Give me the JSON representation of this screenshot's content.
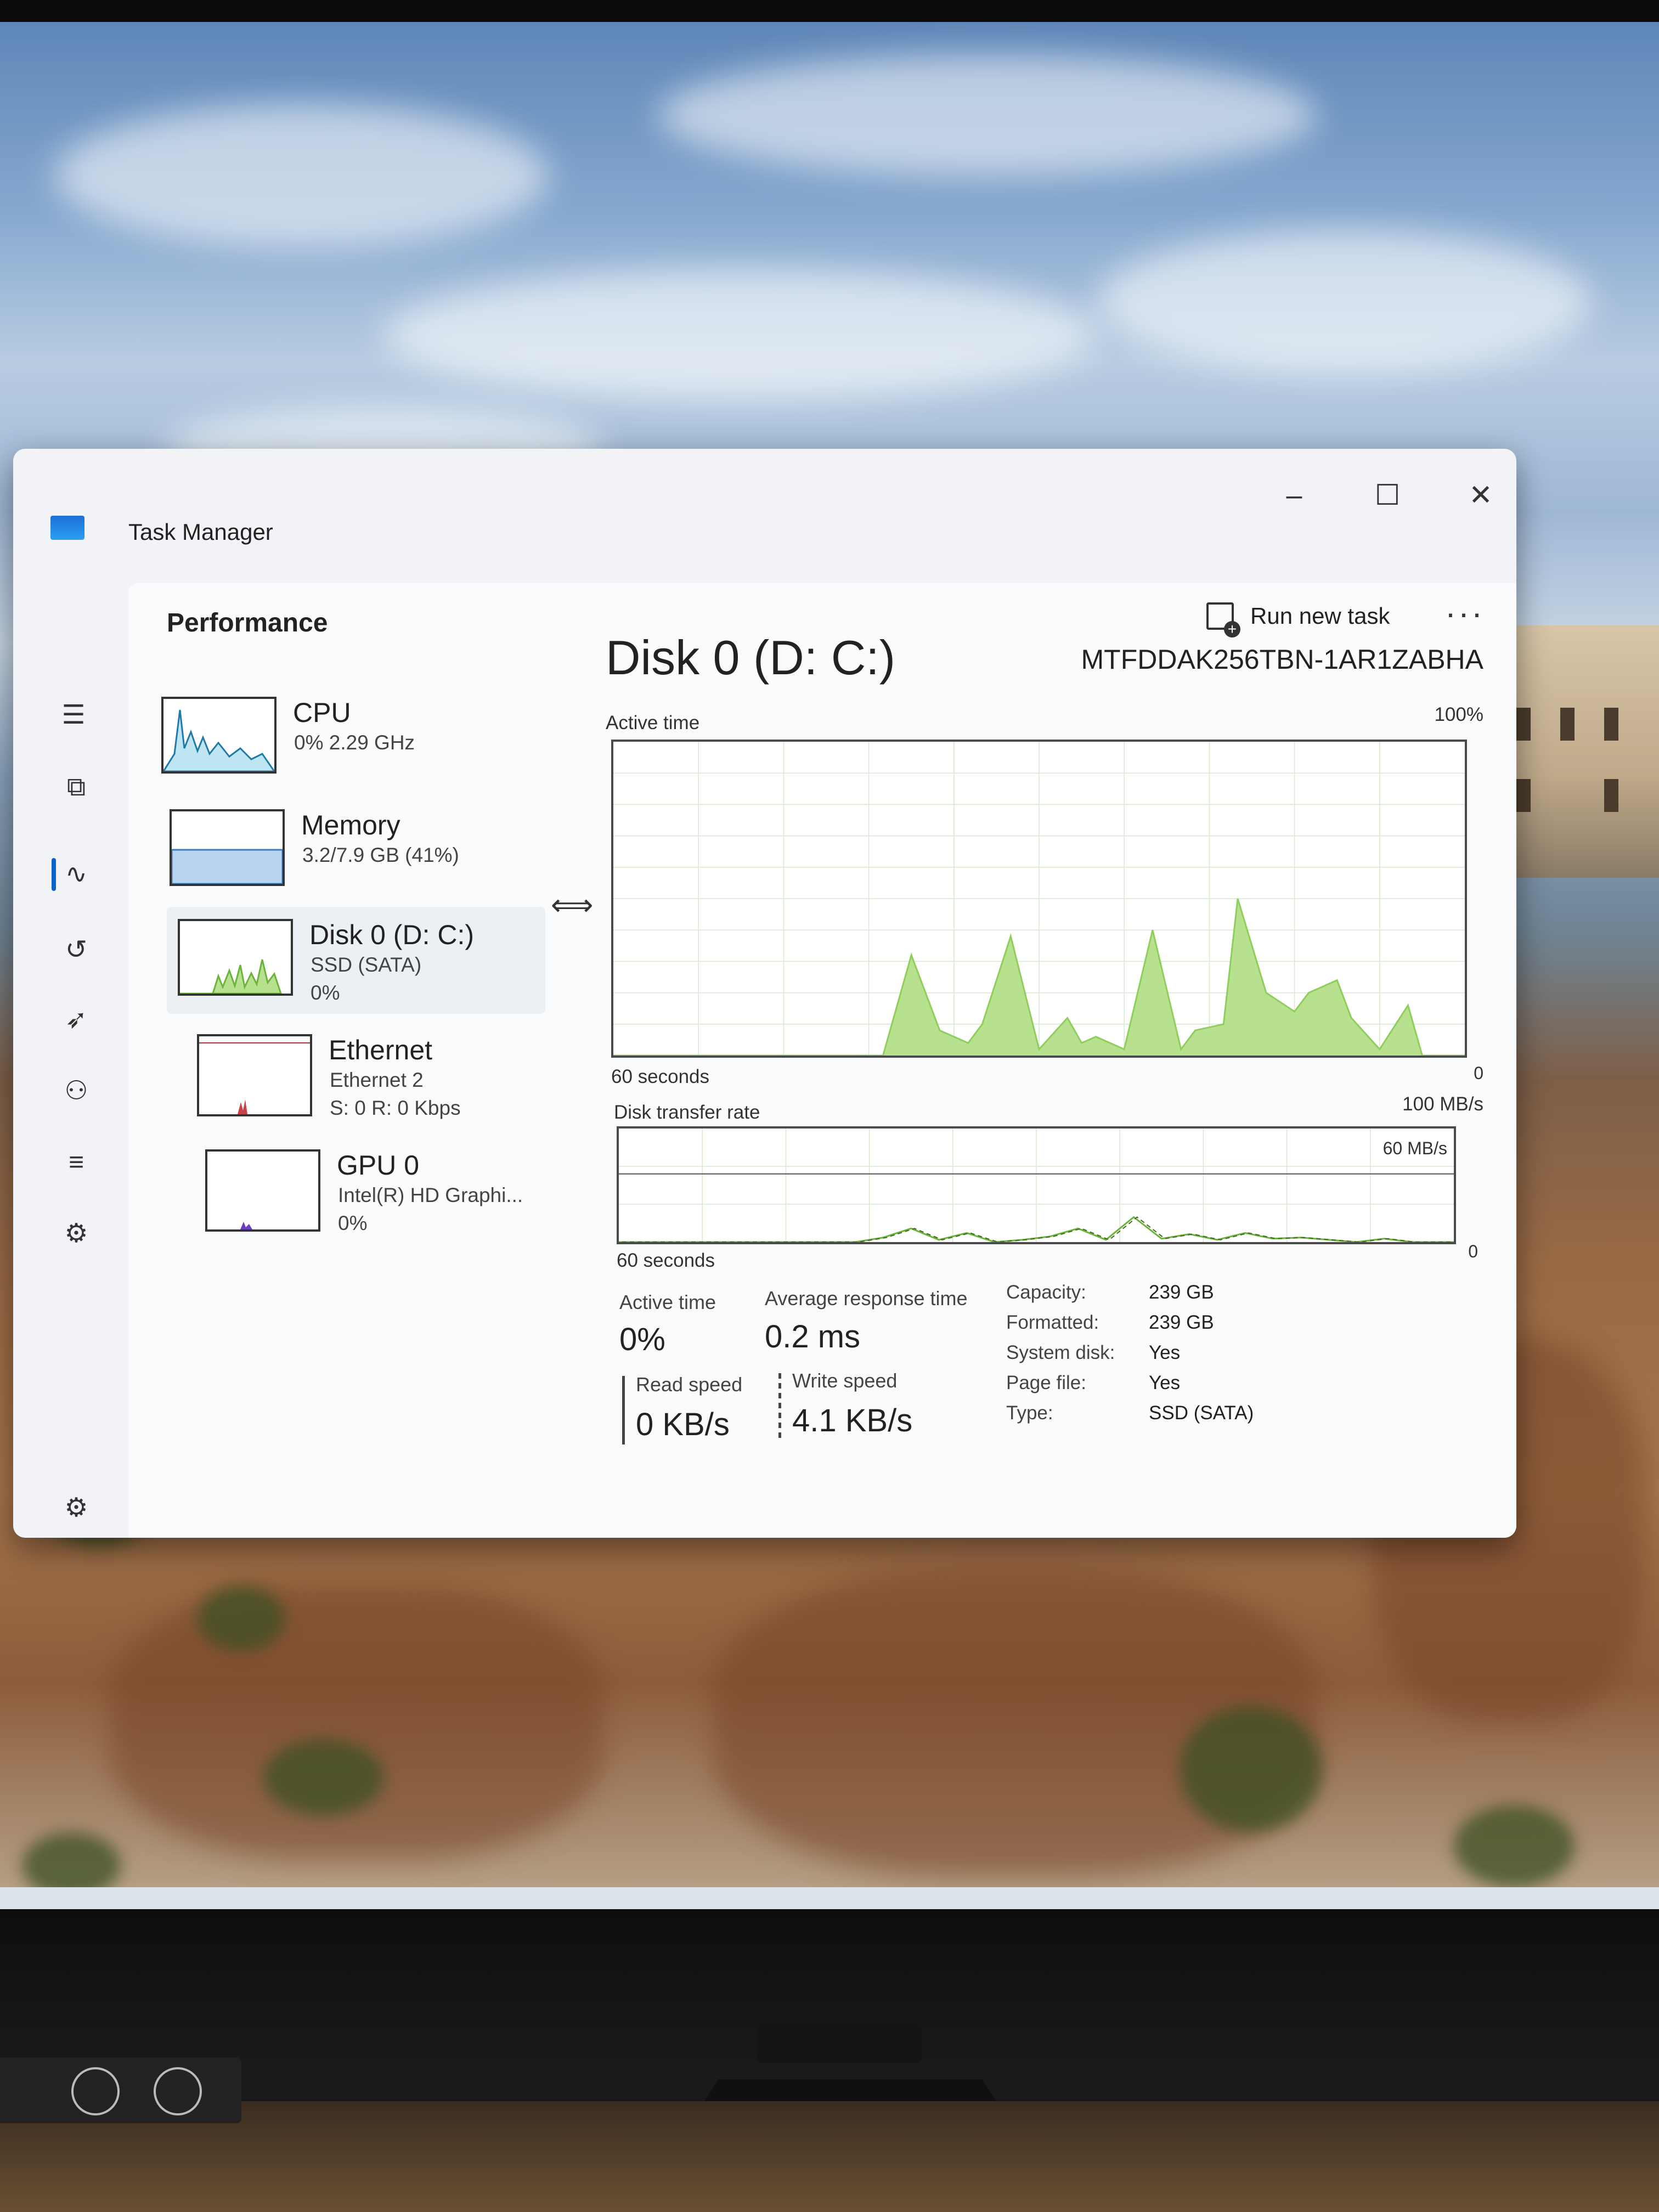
{
  "window": {
    "title": "Task Manager"
  },
  "header": {
    "page_title": "Performance",
    "run_new_task": "Run new task"
  },
  "colors": {
    "disk_graph": "#8fce5a",
    "disk_fill": "#b7e08f",
    "accent": "#0b63c9",
    "cpu_graph": "#1e7aa8"
  },
  "resources": [
    {
      "name": "CPU",
      "sub1": "0% 2.29 GHz",
      "sub2": ""
    },
    {
      "name": "Memory",
      "sub1": "3.2/7.9 GB (41%)",
      "sub2": ""
    },
    {
      "name": "Disk 0 (D: C:)",
      "sub1": "SSD (SATA)",
      "sub2": "0%"
    },
    {
      "name": "Ethernet",
      "sub1": "Ethernet 2",
      "sub2": "S: 0 R: 0 Kbps"
    },
    {
      "name": "GPU 0",
      "sub1": "Intel(R) HD Graphi...",
      "sub2": "0%"
    }
  ],
  "detail": {
    "title": "Disk 0 (D: C:)",
    "model": "MTFDDAK256TBN-1AR1ZABHA",
    "active_time_graph": {
      "label": "Active time",
      "max": "100%",
      "min": "0",
      "span": "60 seconds"
    },
    "transfer_graph": {
      "label": "Disk transfer rate",
      "max": "100 MB/s",
      "mid": "60 MB/s",
      "min": "0",
      "span": "60 seconds"
    }
  },
  "stats": {
    "active_time": {
      "label": "Active time",
      "value": "0%"
    },
    "avg_response": {
      "label": "Average response time",
      "value": "0.2 ms"
    },
    "read_speed": {
      "label": "Read speed",
      "value": "0 KB/s"
    },
    "write_speed": {
      "label": "Write speed",
      "value": "4.1 KB/s"
    }
  },
  "properties": [
    {
      "label": "Capacity:",
      "value": "239 GB"
    },
    {
      "label": "Formatted:",
      "value": "239 GB"
    },
    {
      "label": "System disk:",
      "value": "Yes"
    },
    {
      "label": "Page file:",
      "value": "Yes"
    },
    {
      "label": "Type:",
      "value": "SSD (SATA)"
    }
  ],
  "chart_data": [
    {
      "type": "area",
      "title": "Active time",
      "xlabel": "60 seconds",
      "ylim": [
        0,
        100
      ],
      "x": [
        0,
        2,
        4,
        6,
        8,
        10,
        12,
        14,
        16,
        17,
        19,
        21,
        23,
        25,
        26,
        28,
        30,
        32,
        33,
        34,
        36,
        38,
        40,
        41,
        43,
        44,
        46,
        48,
        49,
        51,
        52,
        54,
        56,
        57,
        58,
        60
      ],
      "series": [
        {
          "values": [
            0,
            0,
            0,
            0,
            0,
            0,
            0,
            0,
            0,
            0,
            0,
            32,
            8,
            4,
            10,
            38,
            2,
            12,
            4,
            6,
            2,
            40,
            2,
            8,
            10,
            50,
            20,
            14,
            20,
            24,
            12,
            2,
            16,
            0,
            0,
            0
          ]
        }
      ]
    },
    {
      "type": "line",
      "title": "Disk transfer rate",
      "xlabel": "60 seconds",
      "ylim": [
        0,
        100
      ],
      "x": [
        0,
        10,
        17,
        19,
        21,
        23,
        25,
        27,
        29,
        31,
        33,
        35,
        37,
        39,
        41,
        43,
        45,
        47,
        49,
        51,
        53,
        55,
        57,
        60
      ],
      "series": [
        {
          "values": [
            0,
            0,
            0,
            4,
            12,
            2,
            8,
            0,
            2,
            5,
            12,
            2,
            22,
            3,
            7,
            2,
            8,
            3,
            4,
            2,
            0,
            3,
            0,
            0
          ]
        }
      ]
    }
  ]
}
